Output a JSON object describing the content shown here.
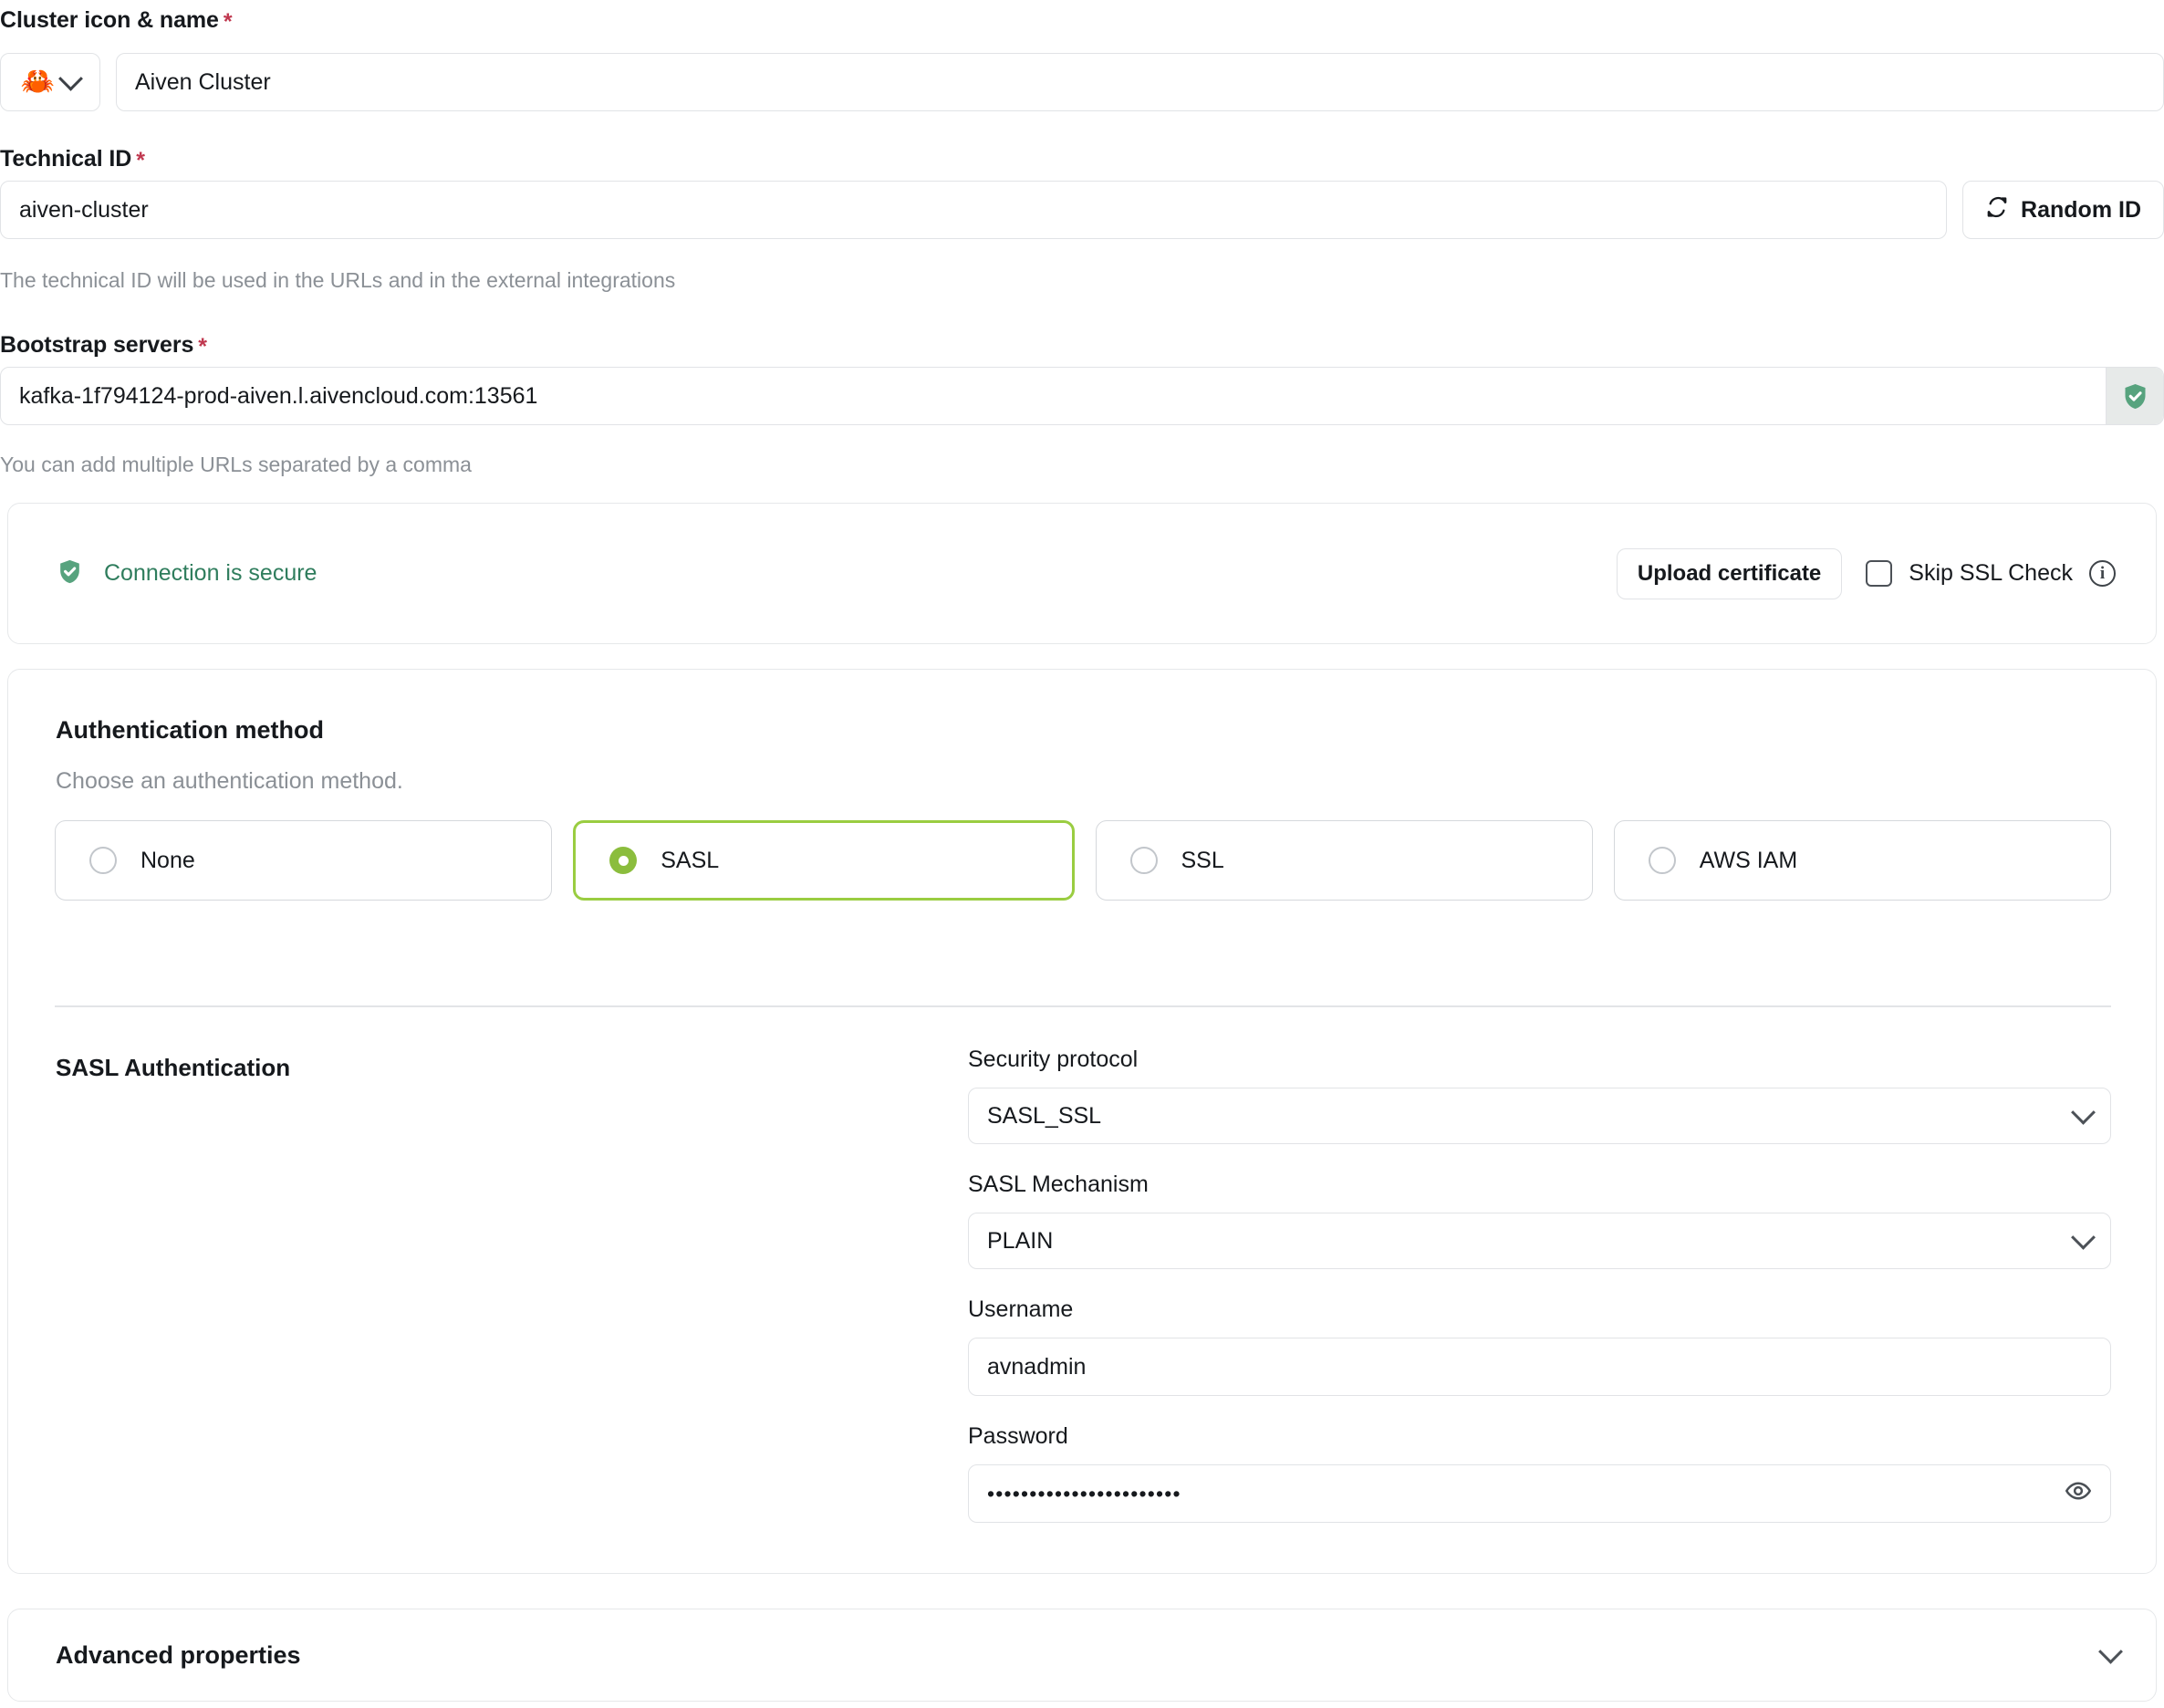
{
  "cluster": {
    "label": "Cluster icon & name",
    "required_marker": "*",
    "icon_glyph": "🦀",
    "icon_name": "crab-emoji",
    "name_value": "Aiven Cluster"
  },
  "technical_id": {
    "label": "Technical ID",
    "required_marker": "*",
    "value": "aiven-cluster",
    "helper": "The technical ID will be used in the URLs and in the external integrations",
    "random_button": "Random ID"
  },
  "bootstrap": {
    "label": "Bootstrap servers",
    "required_marker": "*",
    "value": "kafka-1f794124-prod-aiven.l.aivencloud.com:13561",
    "helper": "You can add multiple URLs separated by a comma"
  },
  "secure_card": {
    "status_text": "Connection is secure",
    "upload_button": "Upload certificate",
    "skip_ssl_label": "Skip SSL Check",
    "skip_ssl_checked": false,
    "info_glyph": "i"
  },
  "auth": {
    "title": "Authentication method",
    "subtitle": "Choose an authentication method.",
    "options": [
      {
        "label": "None",
        "selected": false
      },
      {
        "label": "SASL",
        "selected": true
      },
      {
        "label": "SSL",
        "selected": false
      },
      {
        "label": "AWS IAM",
        "selected": false
      }
    ],
    "section_heading": "SASL Authentication",
    "fields": {
      "security_protocol_label": "Security protocol",
      "security_protocol_value": "SASL_SSL",
      "sasl_mechanism_label": "SASL Mechanism",
      "sasl_mechanism_value": "PLAIN",
      "username_label": "Username",
      "username_value": "avnadmin",
      "password_label": "Password",
      "password_value": "•••••••••••••••••••••••"
    }
  },
  "advanced": {
    "title": "Advanced properties"
  },
  "colors": {
    "accent_green": "#9acd41",
    "radio_fill": "#8bbd3d",
    "secure_green": "#2f7d5d",
    "shield_green": "#57a37e",
    "required_red": "#c0384f",
    "border": "#e1e3e6",
    "muted_text": "#8b9096"
  }
}
